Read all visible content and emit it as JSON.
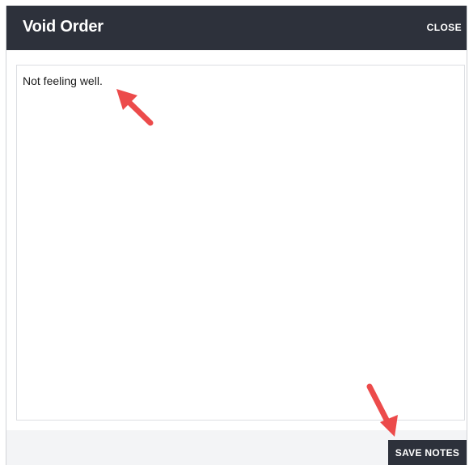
{
  "dialog": {
    "title": "Void Order",
    "close_label": "CLOSE",
    "notes_value": "Not feeling well.",
    "save_label": "SAVE NOTES"
  },
  "colors": {
    "header_bg": "#2d313b",
    "annotation_arrow": "#ec4b4b"
  },
  "annotations": [
    {
      "name": "arrow-to-notes-text",
      "icon": "red-arrow-icon"
    },
    {
      "name": "arrow-to-save-button",
      "icon": "red-arrow-icon"
    }
  ]
}
